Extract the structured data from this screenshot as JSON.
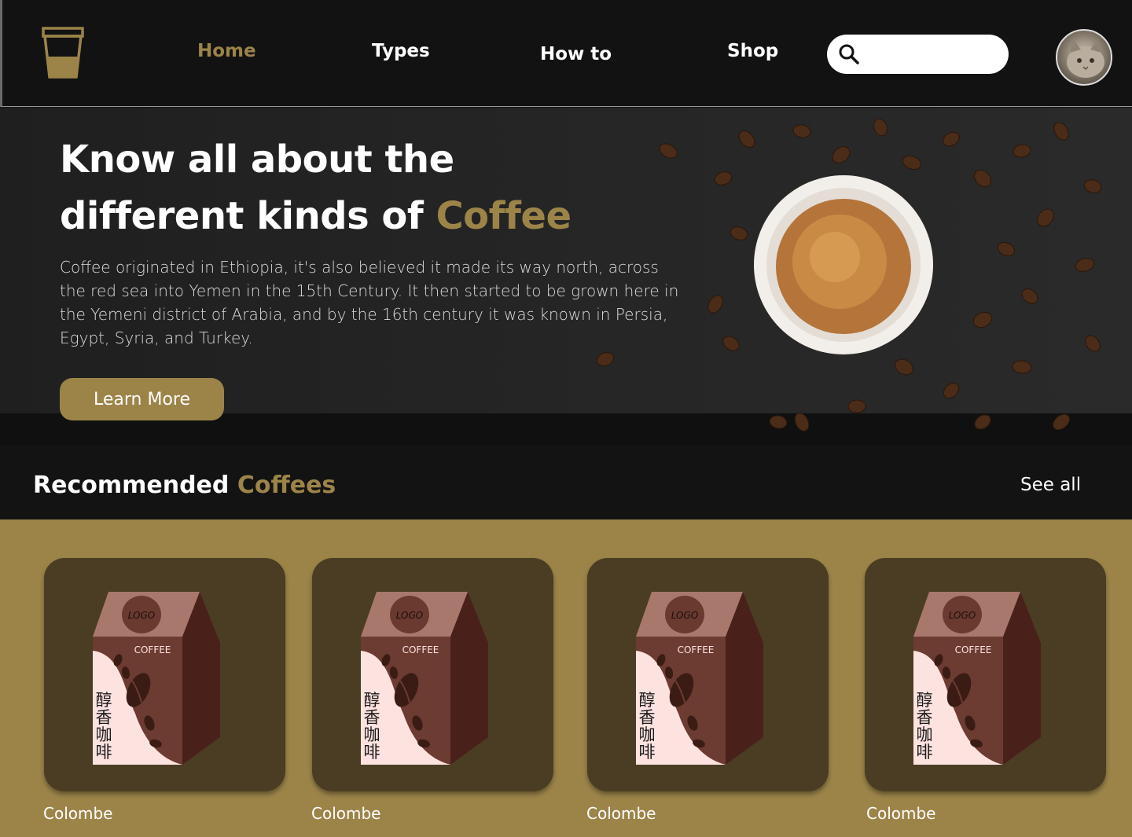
{
  "nav": {
    "links": [
      {
        "label": "Home",
        "active": true
      },
      {
        "label": "Types",
        "active": false
      },
      {
        "label": "How to",
        "active": false
      },
      {
        "label": "Shop",
        "active": false
      }
    ],
    "search": {
      "placeholder": ""
    },
    "logo_icon": "coffee-cup-icon",
    "avatar_icon": "cat-avatar"
  },
  "hero": {
    "title_line1": "Know all about the",
    "title_line2": "different kinds of ",
    "title_accent": "Coffee",
    "body": "Coffee originated in Ethiopia, it's also believed it made its way north, across the red sea into Yemen in the 15th Century. It then started to be grown here in the Yemeni district of Arabia, and by the 16th century it was known in Persia, Egypt, Syria, and Turkey.",
    "button_label": "Learn More"
  },
  "recommended": {
    "title": "Recommended ",
    "title_accent": "Coffees",
    "see_all": "See all",
    "package": {
      "logo": "LOGO",
      "label": "COFFEE",
      "chinese": [
        "醇",
        "香",
        "咖",
        "啡"
      ]
    },
    "products": [
      {
        "name": "Colombe"
      },
      {
        "name": "Colombe"
      },
      {
        "name": "Colombe"
      },
      {
        "name": "Colombe"
      }
    ]
  },
  "colors": {
    "accent": "#9c8449",
    "nav_bg": "#121212",
    "card_bg": "#4a3d23"
  }
}
